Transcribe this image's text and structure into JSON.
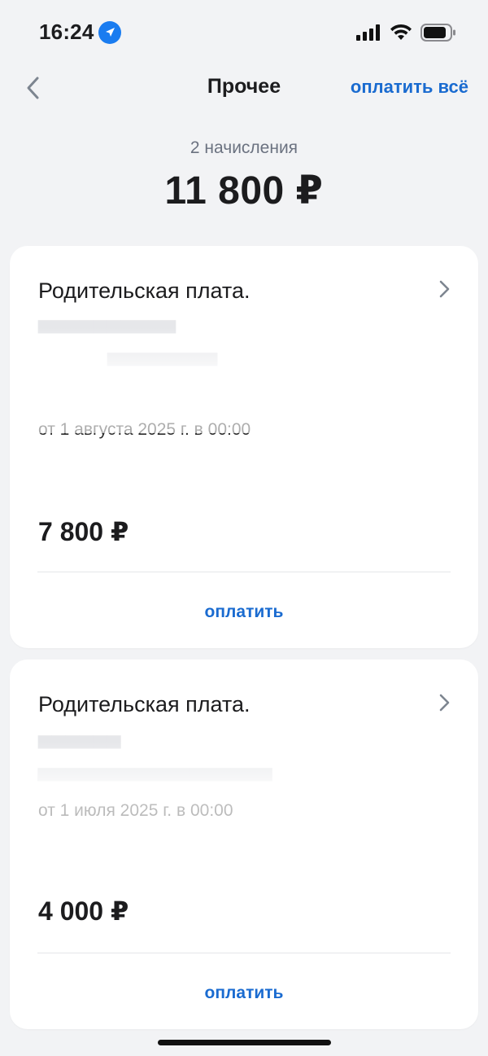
{
  "status": {
    "time": "16:24"
  },
  "nav": {
    "title": "Прочее",
    "pay_all": "оплатить всё"
  },
  "summary": {
    "count": "2 начисления",
    "total": "11 800 ₽"
  },
  "charges": [
    {
      "title": "Родительская плата.",
      "date": "от 1 августа 2025 г. в 00:00",
      "amount": "7 800 ₽",
      "pay_label": "оплатить"
    },
    {
      "title": "Родительская плата.",
      "date": "от 1 июля 2025 г. в 00:00",
      "amount": "4 000 ₽",
      "pay_label": "оплатить"
    }
  ],
  "colors": {
    "accent": "#1a6bd0",
    "background": "#f2f3f5",
    "card": "#ffffff"
  }
}
